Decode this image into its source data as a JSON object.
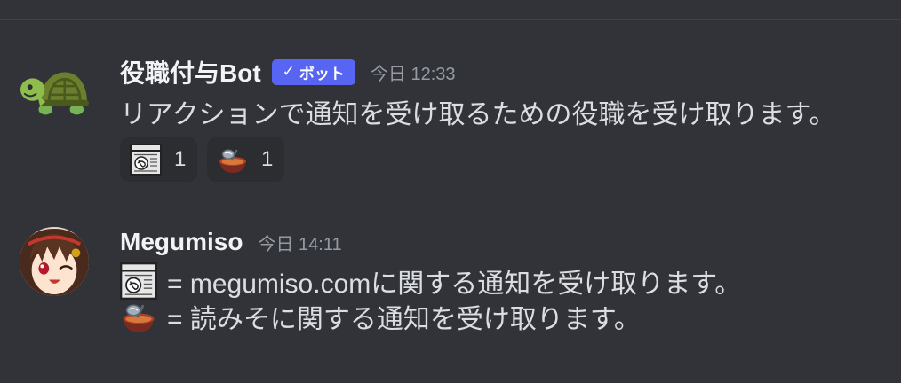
{
  "colors": {
    "background": "#313338",
    "divider": "#3f4147",
    "text": "#dbdee1",
    "username": "#f2f3f5",
    "timestamp": "#949ba4",
    "badge": "#5865f2",
    "reaction": "#2b2d31"
  },
  "messages": [
    {
      "avatar_icon": "turtle-icon",
      "author": "役職付与Bot",
      "badge": {
        "check": "✓",
        "label": "ボット"
      },
      "timestamp": "今日 12:33",
      "content": "リアクションで通知を受け取るための役職を受け取ります。",
      "reactions": [
        {
          "icon": "megumiso-logo-icon",
          "count": "1"
        },
        {
          "icon": "miso-soup-bowl-icon",
          "count": "1"
        }
      ]
    },
    {
      "avatar_icon": "anime-girl-icon",
      "author": "Megumiso",
      "timestamp": "今日 14:11",
      "lines": [
        {
          "icon": "megumiso-logo-icon",
          "text": "= megumiso.comに関する通知を受け取ります。"
        },
        {
          "icon": "miso-soup-bowl-icon",
          "text": "= 読みそに関する通知を受け取ります。"
        }
      ]
    }
  ]
}
